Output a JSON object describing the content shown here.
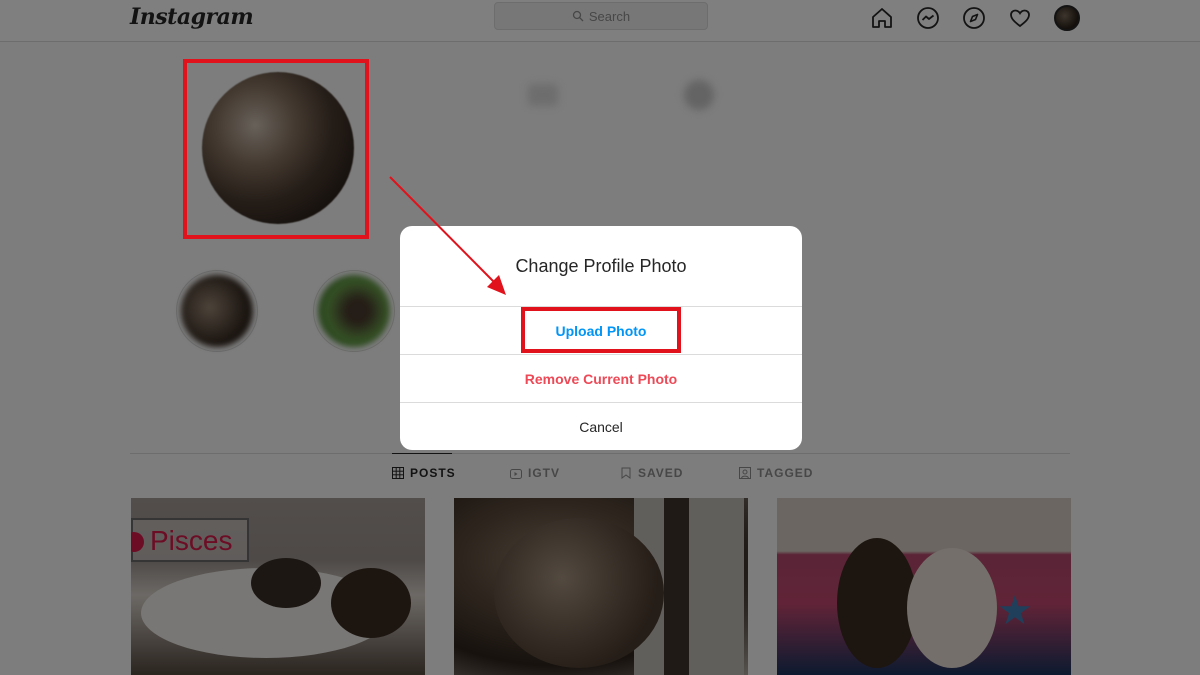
{
  "app": {
    "logo": "Instagram",
    "search_placeholder": "Search"
  },
  "nav_icons": [
    "home-icon",
    "messenger-icon",
    "explore-icon",
    "heart-icon",
    "avatar"
  ],
  "profile": {
    "username": "",
    "edit_label": "",
    "stats": [
      "",
      "",
      ""
    ],
    "name": "",
    "bio": ""
  },
  "highlights": [
    {
      "label": ""
    },
    {
      "label": ""
    }
  ],
  "tabs": [
    {
      "label": "POSTS",
      "icon": "grid-icon",
      "active": true
    },
    {
      "label": "IGTV",
      "icon": "igtv-icon",
      "active": false
    },
    {
      "label": "SAVED",
      "icon": "bookmark-icon",
      "active": false
    },
    {
      "label": "TAGGED",
      "icon": "tag-icon",
      "active": false
    }
  ],
  "posts": [
    {
      "overlay_text": "Pisces"
    },
    {
      "overlay_text": ""
    },
    {
      "overlay_text": ""
    }
  ],
  "modal": {
    "title": "Change Profile Photo",
    "upload": "Upload Photo",
    "remove": "Remove Current Photo",
    "cancel": "Cancel"
  },
  "colors": {
    "upload": "#0095f6",
    "remove": "#ed4956",
    "annotation": "#e1121b"
  }
}
